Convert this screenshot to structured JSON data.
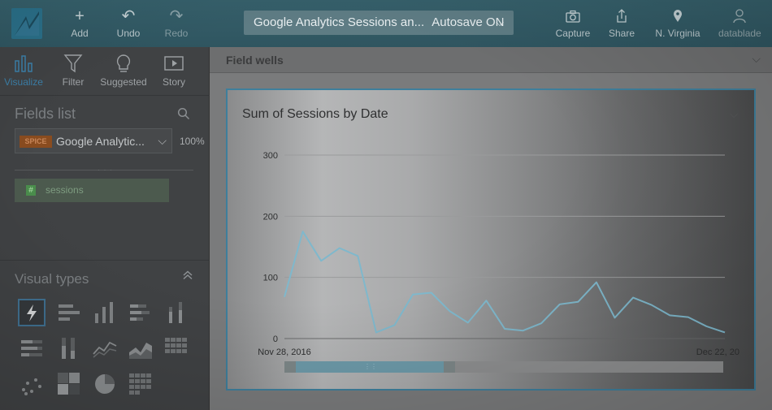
{
  "toolbar": {
    "add": "Add",
    "undo": "Undo",
    "redo": "Redo",
    "analysis_title": "Google Analytics Sessions an...",
    "autosave": "Autosave ON",
    "capture": "Capture",
    "share": "Share",
    "region": "N. Virginia",
    "user": "datablade"
  },
  "left_tabs": [
    "Visualize",
    "Filter",
    "Suggested",
    "Story"
  ],
  "fields_panel": {
    "title": "Fields list",
    "dataset_badge": "SPICE",
    "dataset_name": "Google Analytic...",
    "dataset_pct": "100%",
    "fields": [
      "sessions"
    ]
  },
  "visual_types": {
    "title": "Visual types",
    "icons": [
      "autograph-icon",
      "horizontal-bar-icon",
      "vertical-bar-icon",
      "stacked-horizontal-bar-icon",
      "stacked-vertical-bar-icon",
      "stacked-horizontal-100-icon",
      "stacked-vertical-100-icon",
      "line-chart-icon",
      "area-chart-icon",
      "pivot-table-icon",
      "scatter-plot-icon",
      "heat-map-icon",
      "pie-chart-icon",
      "tree-map-icon"
    ]
  },
  "field_wells": {
    "label": "Field wells"
  },
  "visual": {
    "title": "Sum of Sessions by Date"
  },
  "colors": {
    "accent": "#3e7f9c",
    "line": "#7fb8cc"
  },
  "chart_data": {
    "type": "line",
    "title": "Sum of Sessions by Date",
    "xlabel": "",
    "ylabel": "",
    "ylim": [
      0,
      300
    ],
    "yticks": [
      0,
      100,
      200,
      300
    ],
    "x_first_label": "Nov 28, 2016",
    "x_last_label": "Dec 22, 20",
    "series": [
      {
        "values": [
          68,
          175,
          127,
          148,
          135,
          10,
          22,
          72,
          75,
          45,
          26,
          62,
          16,
          13,
          25,
          56,
          60,
          92,
          34,
          67,
          55,
          38,
          35,
          20,
          10
        ]
      }
    ]
  }
}
